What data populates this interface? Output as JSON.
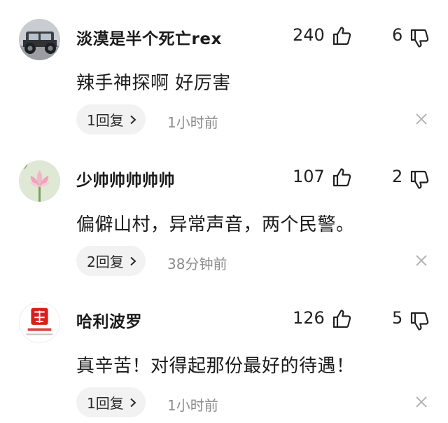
{
  "comments": [
    {
      "username": "淡漠是半个死亡rex",
      "content": "辣手神探啊 好厉害",
      "likes": "240",
      "dislikes": "6",
      "reply": "1回复",
      "time": "1小时前",
      "avatar": "jeep-photo"
    },
    {
      "username": "少帅帅帅帅帅",
      "content": "偏僻山村，异常声音，两个民警。",
      "likes": "107",
      "dislikes": "2",
      "reply": "2回复",
      "time": "38分钟前",
      "avatar": "lotus-photo"
    },
    {
      "username": "哈利波罗",
      "content": "真辛苦！对得起那份最好的待遇！",
      "likes": "126",
      "dislikes": "5",
      "reply": "1回复",
      "time": "1小时前",
      "avatar": "xuexi-logo",
      "avatar_logo_text": "学习强国"
    }
  ],
  "icons": {
    "like": "thumbs-up-icon",
    "dislike": "thumbs-down-icon",
    "close": "close-icon",
    "chevron": "chevron-right-icon"
  },
  "colors": {
    "text": "#1b1b1b",
    "muted": "#8c8c8c",
    "reply_bg": "#f2f2f2",
    "logo_red": "#d6201b"
  }
}
